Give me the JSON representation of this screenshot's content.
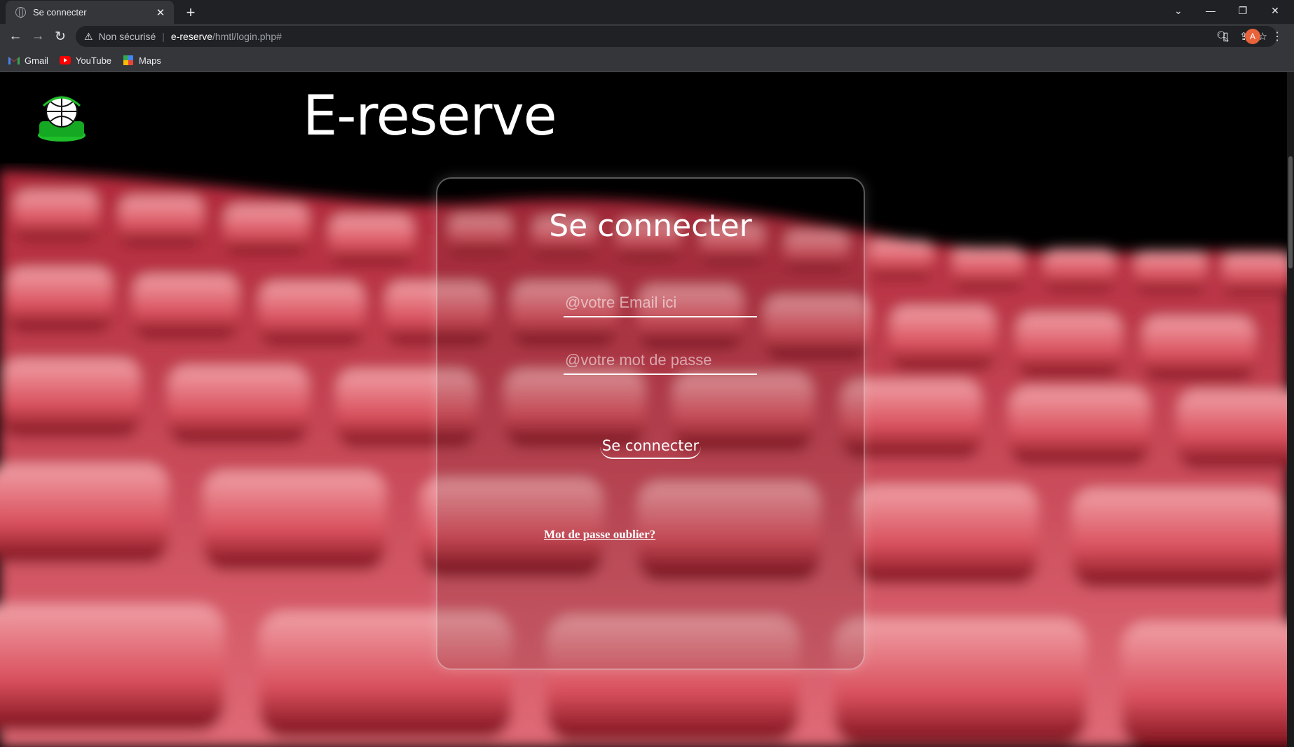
{
  "browser": {
    "tab_title": "Se connecter",
    "new_tab_symbol": "+",
    "security_label": "Non sécurisé",
    "url_host": "e-reserve",
    "url_path": "/hmtl/login.php#",
    "profile_initial": "A",
    "bookmarks": [
      {
        "label": "Gmail",
        "icon": "gmail-icon"
      },
      {
        "label": "YouTube",
        "icon": "youtube-icon"
      },
      {
        "label": "Maps",
        "icon": "maps-icon"
      }
    ]
  },
  "header": {
    "brand": "E-reserve",
    "logo_icon": "globe-logo"
  },
  "login": {
    "title": "Se connecter",
    "email_placeholder": "@votre Email ici",
    "password_placeholder": "@votre mot de passe",
    "submit_label": "Se connecter",
    "forgot_link": "Mot de passe oublier?"
  },
  "colors": {
    "seat_red": "#d94a5a",
    "background": "#000000",
    "avatar": "#e8623a"
  }
}
